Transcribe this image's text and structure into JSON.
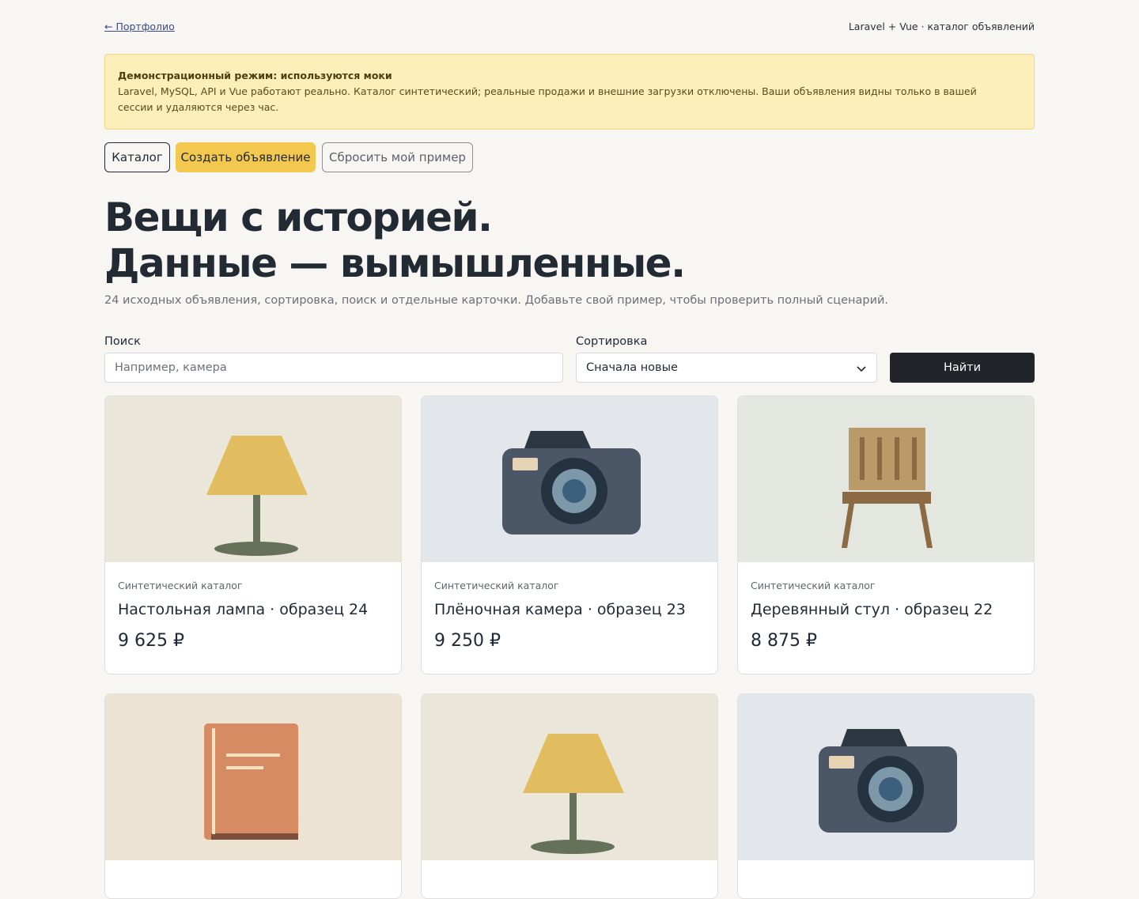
{
  "topbar": {
    "back_link": "← Портфолио",
    "meta": "Laravel + Vue · каталог объявлений"
  },
  "notice": {
    "title": "Демонстрационный режим: используются моки",
    "text": "Laravel, MySQL, API и Vue работают реально. Каталог синтетический; реальные продажи и внешние загрузки отключены. Ваши объявления видны только в вашей сессии и удаляются через час."
  },
  "nav": {
    "catalog": "Каталог",
    "create": "Создать объявление",
    "reset": "Сбросить мой пример"
  },
  "hero": {
    "line1": "Вещи с историей.",
    "line2": "Данные — вымышленные.",
    "subtitle": "24 исходных объявления, сортировка, поиск и отдельные карточки. Добавьте свой пример, чтобы проверить полный сценарий."
  },
  "filters": {
    "search_label": "Поиск",
    "search_placeholder": "Например, камера",
    "search_value": "",
    "sort_label": "Сортировка",
    "sort_value": "Сначала новые",
    "submit": "Найти"
  },
  "listings": [
    {
      "category": "Синтетический каталог",
      "title": "Настольная лампа · образец 24",
      "price": "9 625 ₽",
      "icon": "lamp-icon"
    },
    {
      "category": "Синтетический каталог",
      "title": "Плёночная камера · образец 23",
      "price": "9 250 ₽",
      "icon": "camera-icon"
    },
    {
      "category": "Синтетический каталог",
      "title": "Деревянный стул · образец 22",
      "price": "8 875 ₽",
      "icon": "chair-icon"
    },
    {
      "category": "",
      "title": "",
      "price": "",
      "icon": "book-icon"
    },
    {
      "category": "",
      "title": "",
      "price": "",
      "icon": "lamp-icon"
    },
    {
      "category": "",
      "title": "",
      "price": "",
      "icon": "camera-icon"
    }
  ],
  "colors": {
    "background": "#f7f6f2",
    "accent": "#f2c84e",
    "notice_bg": "#fdefba",
    "primary_button": "#212529"
  }
}
